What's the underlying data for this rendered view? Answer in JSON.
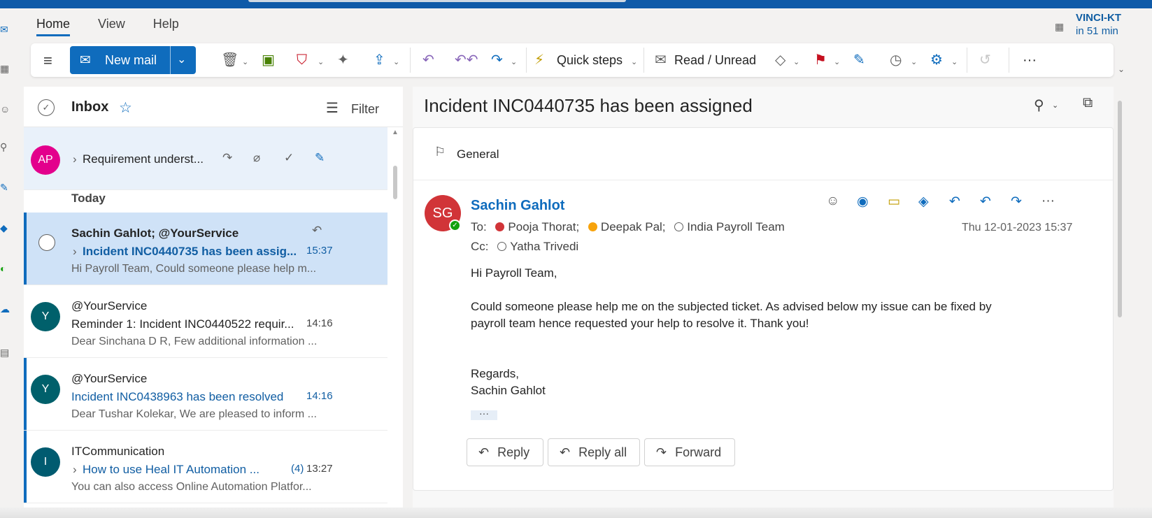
{
  "nav": {
    "tabs": [
      "Home",
      "View",
      "Help"
    ]
  },
  "calendar": {
    "title": "VINCI-KT",
    "subtitle": "in 51 min"
  },
  "ribbon": {
    "new_mail": "New mail",
    "quick_steps": "Quick steps",
    "read_unread": "Read / Unread",
    "icons": {
      "menu": "≡",
      "mail": "✉",
      "delete": "🗑",
      "archive": "▣",
      "report": "⛉",
      "sweep": "✦",
      "move": "⇪",
      "reply": "↶",
      "reply_all": "↶↶",
      "forward": "↷",
      "lightning": "⚡",
      "envelope_open": "✉",
      "tag": "◇",
      "flag": "⚑",
      "pin": "✎",
      "snooze": "◷",
      "rules": "⚙",
      "undo": "↺",
      "more": "···",
      "caret": "⌄"
    }
  },
  "list": {
    "header": {
      "title": "Inbox",
      "filter": "Filter"
    },
    "today_label": "Today",
    "pinned": {
      "initials": "AP",
      "subject": "Requirement underst...",
      "avatar_color": "#e3008c"
    },
    "messages": [
      {
        "initials": "",
        "from": "Sachin Gahlot; @YourService",
        "subject": "Incident INC0440735 has been assig...",
        "time": "15:37",
        "preview": "Hi Payroll Team, Could someone please help m...",
        "selected": true,
        "unread": true
      },
      {
        "initials": "Y",
        "from": "@YourService",
        "subject": "Reminder 1: Incident INC0440522 requir...",
        "time": "14:16",
        "preview": "Dear Sinchana D R, Few additional information ...",
        "avatar_color": "#00606b"
      },
      {
        "initials": "Y",
        "from": "@YourService",
        "subject": "Incident INC0438963 has been resolved",
        "time": "14:16",
        "preview": "Dear Tushar Kolekar, We are pleased to inform ...",
        "avatar_color": "#00606b",
        "unread": true
      },
      {
        "initials": "I",
        "from": "ITCommunication",
        "subject": "How to use Heal IT Automation ...",
        "count": "(4)",
        "time": "13:27",
        "preview": "You can also access Online Automation Platfor...",
        "avatar_color": "#005b70",
        "unread": true
      }
    ]
  },
  "reading": {
    "subject": "Incident INC0440735 has been assigned",
    "category": "General",
    "sender": {
      "initials": "SG",
      "name": "Sachin Gahlot",
      "avatar_color": "#d13438"
    },
    "to_label": "To:",
    "to": [
      {
        "name": "Pooja Thorat;",
        "status": "busy"
      },
      {
        "name": "Deepak Pal;",
        "status": "away"
      },
      {
        "name": "India Payroll Team",
        "status": "none"
      }
    ],
    "cc_label": "Cc:",
    "cc": [
      {
        "name": "Yatha Trivedi",
        "status": "none"
      }
    ],
    "date": "Thu 12-01-2023 15:37",
    "body": {
      "greeting": "Hi Payroll Team,",
      "line1": "Could someone please help me on the subjected ticket. As advised below my issue can be fixed by",
      "line2": "payroll team hence requested your help to resolve it. Thank you!",
      "closing": "Regards,",
      "signature": "Sachin Gahlot"
    },
    "buttons": {
      "reply": "Reply",
      "reply_all": "Reply all",
      "forward": "Forward"
    }
  }
}
